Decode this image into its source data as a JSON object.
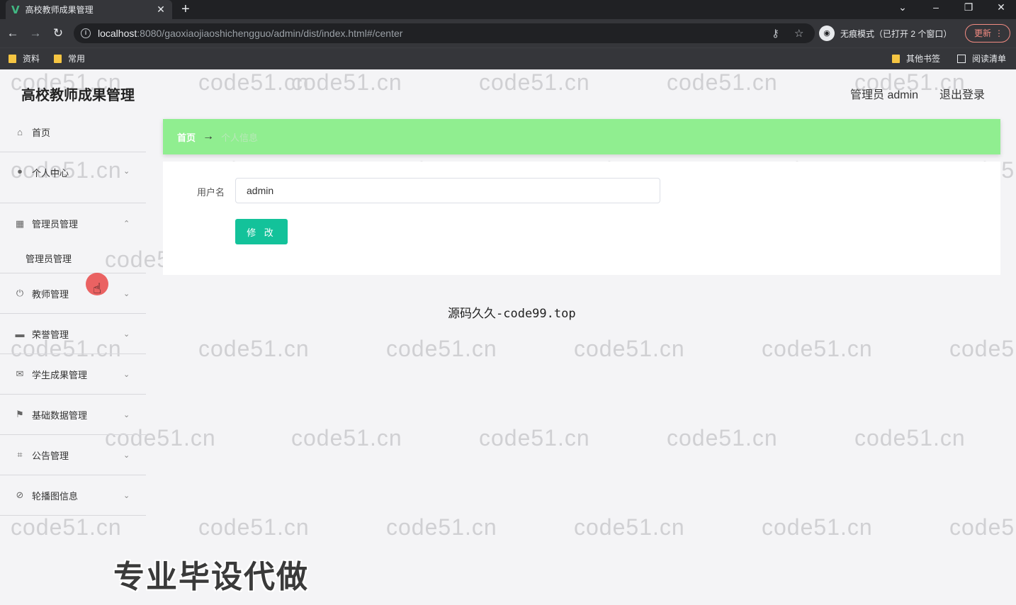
{
  "browser": {
    "tab_title": "高校教师成果管理",
    "tab_favicon": "V",
    "url_host": "localhost",
    "url_rest": ":8080/gaoxiaojiaoshichengguo/admin/dist/index.html#/center",
    "incognito_label": "无痕模式（已打开 2 个窗口）",
    "update_label": "更新",
    "bookmarks": [
      "资料",
      "常用"
    ],
    "bookmarks_right": [
      "其他书签",
      "阅读清单"
    ]
  },
  "header": {
    "app_title": "高校教师成果管理",
    "user_label": "管理员 admin",
    "logout_label": "退出登录"
  },
  "sidebar": {
    "items": [
      {
        "label": "首页",
        "icon": "home-icon"
      },
      {
        "label": "个人中心",
        "icon": "user-icon"
      },
      {
        "label": "管理员管理",
        "icon": "grid-icon"
      },
      {
        "label": "管理员管理",
        "icon": ""
      },
      {
        "label": "教师管理",
        "icon": "power-icon"
      },
      {
        "label": "荣誉管理",
        "icon": "tag-icon"
      },
      {
        "label": "学生成果管理",
        "icon": "mail-icon"
      },
      {
        "label": "基础数据管理",
        "icon": "flag-icon"
      },
      {
        "label": "公告管理",
        "icon": "crop-icon"
      },
      {
        "label": "轮播图信息",
        "icon": "eye-off-icon"
      }
    ]
  },
  "breadcrumb": {
    "home": "首页",
    "separator": "→",
    "current": "个人信息"
  },
  "form": {
    "username_label": "用户名",
    "username_value": "admin",
    "submit_label": "修 改"
  },
  "footer_text": "源码久久-code99.top",
  "promo_text": "专业毕设代做",
  "watermark_text": "code51.cn",
  "colors": {
    "breadcrumb_bg": "#90ee90",
    "submit_bg": "#13c29a"
  }
}
